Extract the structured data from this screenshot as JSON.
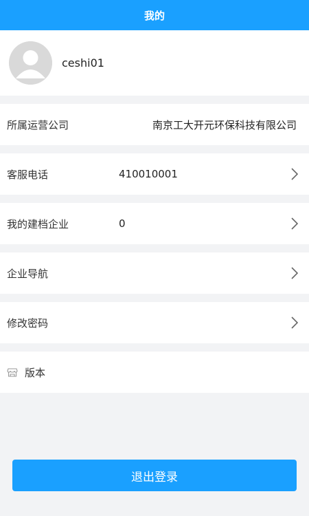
{
  "header": {
    "title": "我的"
  },
  "profile": {
    "username": "ceshi01"
  },
  "rows": {
    "company": {
      "label": "所属运营公司",
      "value": "南京工大开元环保科技有限公司"
    },
    "service_phone": {
      "label": "客服电话",
      "value": "410010001"
    },
    "archived": {
      "label": "我的建档企业",
      "value": "0"
    },
    "navigation": {
      "label": "企业导航"
    },
    "password": {
      "label": "修改密码"
    },
    "version": {
      "label": "版本",
      "icon": "store-icon"
    }
  },
  "logout": {
    "label": "退出登录"
  },
  "colors": {
    "accent": "#1aa0ff",
    "background": "#f2f3f5"
  }
}
